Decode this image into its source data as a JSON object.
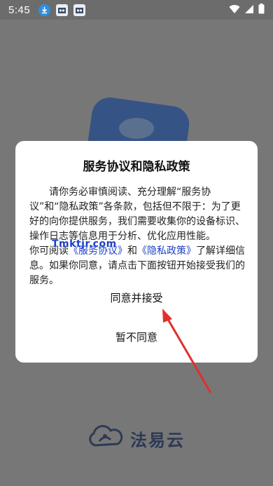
{
  "status_bar": {
    "time": "5:45"
  },
  "background": {
    "logo_text": "法易云"
  },
  "dialog": {
    "title": "服务协议和隐私政策",
    "body_part1": "请你务必审慎阅读、充分理解“服务协议”和“隐私政策”各条款，包括但不限于：为了更好的向你提供服务，我们需要收集你的设备标识、操作日志等信息用于分析、优化应用性能。",
    "body_part2_prefix": "你可阅读",
    "link_service": "《服务协议》",
    "body_and": "和",
    "link_privacy": "《隐私政策》",
    "body_part2_suffix": "了解详细信息。如果你同意，请点击下面按钮开始接受我们的服务。",
    "agree_label": "同意并接受",
    "decline_label": "暂不同意"
  },
  "watermark": "Tmktjr.com",
  "colors": {
    "link": "#1e40c8",
    "arrow": "#e0302a",
    "dim_overlay": "#777777"
  }
}
